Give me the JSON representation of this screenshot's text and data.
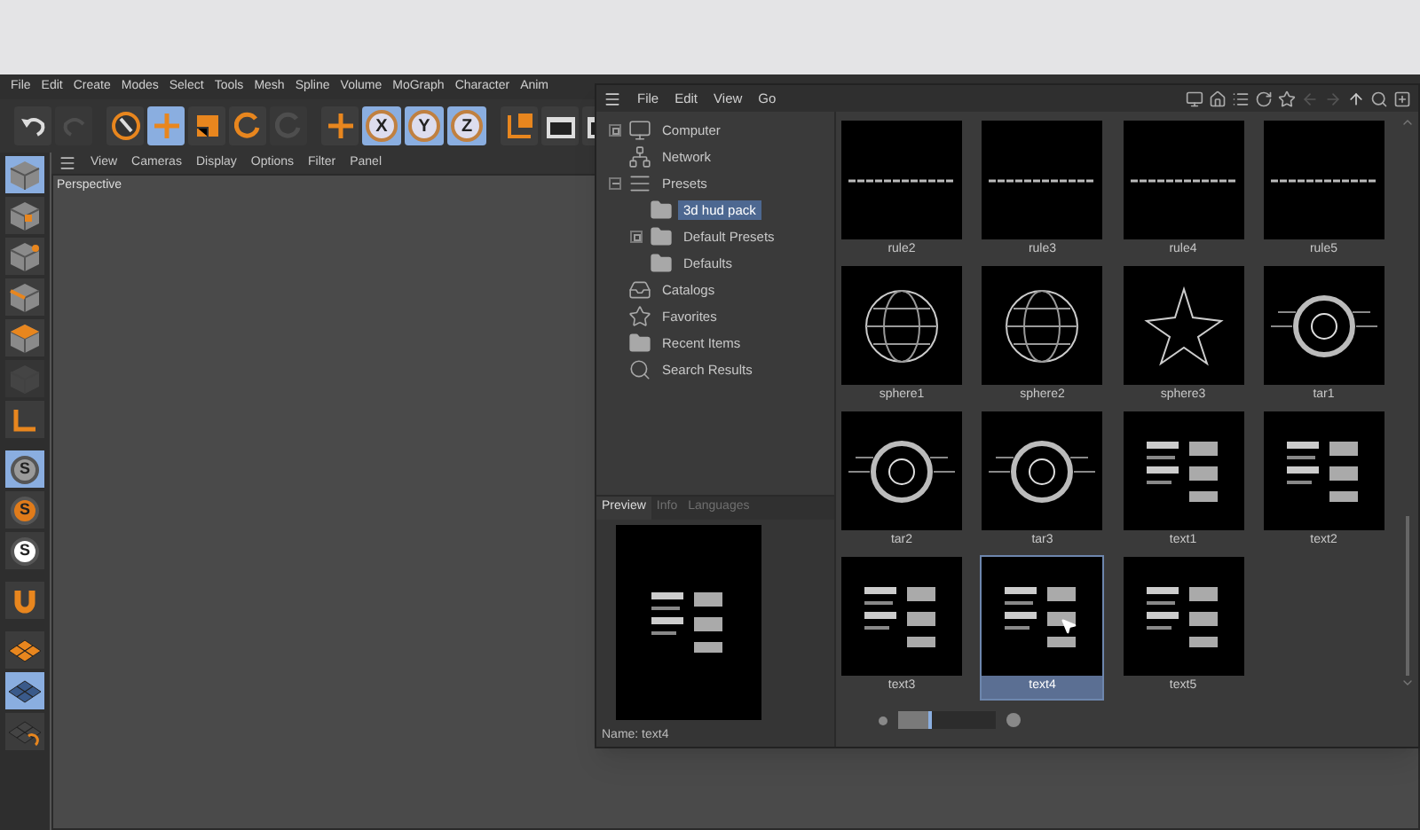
{
  "main_menu": [
    "File",
    "Edit",
    "Create",
    "Modes",
    "Select",
    "Tools",
    "Mesh",
    "Spline",
    "Volume",
    "MoGraph",
    "Character",
    "Anim"
  ],
  "toolbar": [
    {
      "kind": "undo",
      "active": false,
      "disabled": false
    },
    {
      "kind": "redo",
      "active": false,
      "disabled": true
    },
    {
      "kind": "select",
      "active": false,
      "disabled": false
    },
    {
      "kind": "move",
      "active": true,
      "disabled": false
    },
    {
      "kind": "scale",
      "active": false,
      "disabled": false
    },
    {
      "kind": "rotate",
      "active": false,
      "disabled": false
    },
    {
      "kind": "recent",
      "active": false,
      "disabled": true
    },
    {
      "kind": "add",
      "active": false,
      "disabled": false
    },
    {
      "kind": "axis",
      "label": "X",
      "active": true,
      "disabled": false
    },
    {
      "kind": "axis",
      "label": "Y",
      "active": true,
      "disabled": false
    },
    {
      "kind": "axis",
      "label": "Z",
      "active": true,
      "disabled": false
    },
    {
      "kind": "coords",
      "active": false,
      "disabled": false
    },
    {
      "kind": "render",
      "active": false,
      "disabled": false
    },
    {
      "kind": "render-view",
      "active": false,
      "disabled": false
    }
  ],
  "side_tools": [
    {
      "kind": "model",
      "active": true,
      "disabled": false
    },
    {
      "kind": "texture",
      "active": false,
      "disabled": false
    },
    {
      "kind": "points",
      "active": false,
      "disabled": false
    },
    {
      "kind": "edges",
      "active": false,
      "disabled": false
    },
    {
      "kind": "polygons",
      "active": false,
      "disabled": false
    },
    {
      "kind": "uv",
      "active": false,
      "disabled": true
    },
    {
      "kind": "axis",
      "active": false,
      "disabled": false
    },
    {
      "kind": "snap",
      "label": "S",
      "color": "#9a9a9a",
      "active": true,
      "disabled": false
    },
    {
      "kind": "snap",
      "label": "S",
      "color": "#e07b1a",
      "active": false,
      "disabled": false
    },
    {
      "kind": "snap",
      "label": "S",
      "color": "#ffffff",
      "active": false,
      "disabled": false
    },
    {
      "kind": "magnet",
      "active": false,
      "disabled": false
    },
    {
      "kind": "plane",
      "active": false,
      "disabled": false
    },
    {
      "kind": "plane-grid",
      "active": true,
      "disabled": false
    },
    {
      "kind": "plane-lock",
      "active": false,
      "disabled": false
    }
  ],
  "viewport": {
    "menu": [
      "View",
      "Cameras",
      "Display",
      "Options",
      "Filter",
      "Panel"
    ],
    "title": "Perspective"
  },
  "content_browser": {
    "menu": [
      "File",
      "Edit",
      "View",
      "Go"
    ],
    "tree": [
      {
        "label": "Computer",
        "kind": "computer",
        "expanded": false,
        "selected": false
      },
      {
        "label": "Network",
        "kind": "network",
        "selected": false
      },
      {
        "label": "Presets",
        "kind": "presets",
        "expanded": true,
        "selected": false,
        "children": [
          {
            "label": "3d hud pack",
            "kind": "folder",
            "selected": true
          },
          {
            "label": "Default Presets",
            "kind": "folder",
            "expanded": false,
            "selected": false
          },
          {
            "label": "Defaults",
            "kind": "folder",
            "selected": false
          }
        ]
      },
      {
        "label": "Catalogs",
        "kind": "catalog",
        "selected": false
      },
      {
        "label": "Favorites",
        "kind": "favorites",
        "selected": false
      },
      {
        "label": "Recent Items",
        "kind": "folder",
        "selected": false
      },
      {
        "label": "Search Results",
        "kind": "search",
        "selected": false
      }
    ],
    "preview_tabs": [
      {
        "label": "Preview",
        "selected": true
      },
      {
        "label": "Info",
        "selected": false
      },
      {
        "label": "Languages",
        "selected": false
      }
    ],
    "preview_name": "Name: text4",
    "items": [
      {
        "name": "rule2",
        "kind": "rule",
        "selected": false
      },
      {
        "name": "rule3",
        "kind": "rule",
        "selected": false
      },
      {
        "name": "rule4",
        "kind": "rule",
        "selected": false
      },
      {
        "name": "rule5",
        "kind": "rule",
        "selected": false
      },
      {
        "name": "sphere1",
        "kind": "sphere",
        "selected": false
      },
      {
        "name": "sphere2",
        "kind": "sphere",
        "selected": false
      },
      {
        "name": "sphere3",
        "kind": "star",
        "selected": false
      },
      {
        "name": "tar1",
        "kind": "target",
        "selected": false
      },
      {
        "name": "tar2",
        "kind": "target",
        "selected": false
      },
      {
        "name": "tar3",
        "kind": "target",
        "selected": false
      },
      {
        "name": "text1",
        "kind": "text",
        "selected": false
      },
      {
        "name": "text2",
        "kind": "text",
        "selected": false
      },
      {
        "name": "text3",
        "kind": "text",
        "selected": false
      },
      {
        "name": "text4",
        "kind": "text",
        "selected": true
      },
      {
        "name": "text5",
        "kind": "text",
        "selected": false
      }
    ],
    "thumb_size": {
      "level": 0.35
    }
  }
}
